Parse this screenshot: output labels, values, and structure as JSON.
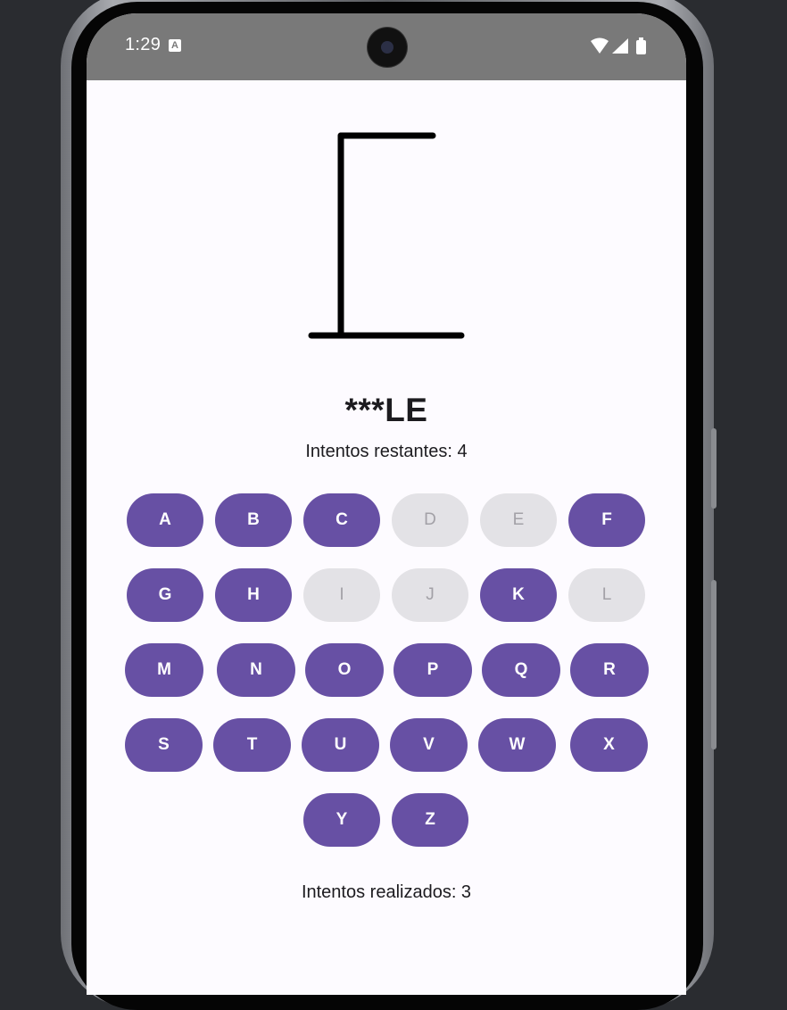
{
  "status_bar": {
    "time": "1:29",
    "notification_icon_letter": "A",
    "icons": [
      "wifi-icon",
      "cellular-signal-icon",
      "battery-icon"
    ]
  },
  "game": {
    "masked_word": "***LE",
    "remaining_attempts_text": "Intentos restantes: 4",
    "attempts_made_text": "Intentos realizados: 3",
    "gallows_stage": "base-and-post",
    "keys": [
      {
        "letter": "A",
        "enabled": true
      },
      {
        "letter": "B",
        "enabled": true
      },
      {
        "letter": "C",
        "enabled": true
      },
      {
        "letter": "D",
        "enabled": false
      },
      {
        "letter": "E",
        "enabled": false
      },
      {
        "letter": "F",
        "enabled": true
      },
      {
        "letter": "G",
        "enabled": true
      },
      {
        "letter": "H",
        "enabled": true
      },
      {
        "letter": "I",
        "enabled": false
      },
      {
        "letter": "J",
        "enabled": false
      },
      {
        "letter": "K",
        "enabled": true
      },
      {
        "letter": "L",
        "enabled": false
      },
      {
        "letter": "M",
        "enabled": true
      },
      {
        "letter": "N",
        "enabled": true
      },
      {
        "letter": "O",
        "enabled": true
      },
      {
        "letter": "P",
        "enabled": true
      },
      {
        "letter": "Q",
        "enabled": true
      },
      {
        "letter": "R",
        "enabled": true
      },
      {
        "letter": "S",
        "enabled": true
      },
      {
        "letter": "T",
        "enabled": true
      },
      {
        "letter": "U",
        "enabled": true
      },
      {
        "letter": "V",
        "enabled": true
      },
      {
        "letter": "W",
        "enabled": true
      },
      {
        "letter": "X",
        "enabled": true
      },
      {
        "letter": "Y",
        "enabled": true
      },
      {
        "letter": "Z",
        "enabled": true
      }
    ]
  },
  "colors": {
    "key_enabled": "#6750a4",
    "key_disabled": "#e3e2e6",
    "status_bar": "#797979",
    "background": "#fdfbff"
  }
}
